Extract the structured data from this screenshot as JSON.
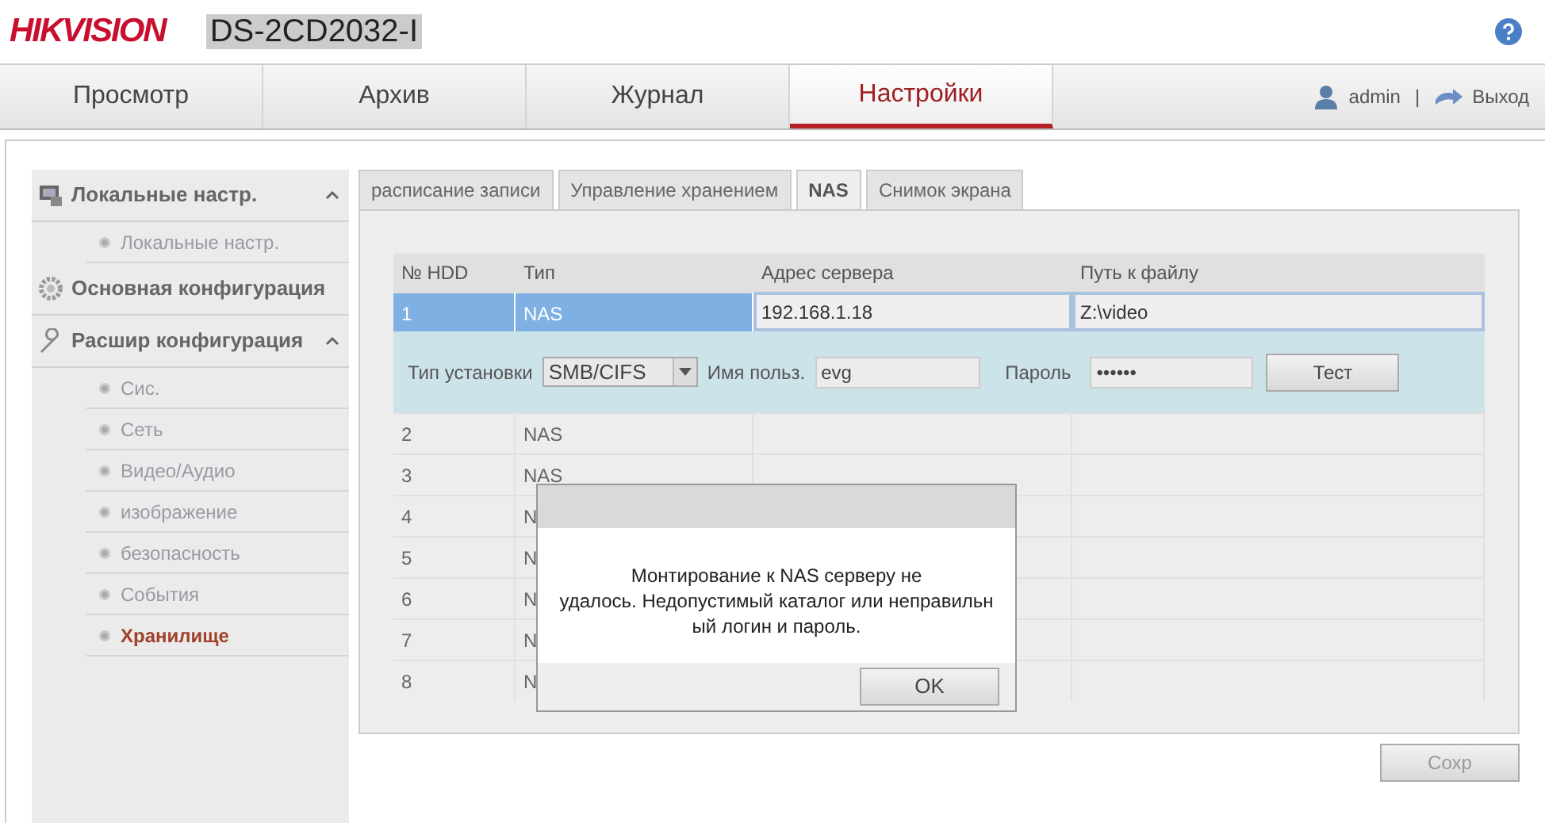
{
  "header": {
    "logo": "HIKVISION",
    "device": "DS-2CD2032-I"
  },
  "nav": {
    "tabs": [
      {
        "label": "Просмотр",
        "selected": false
      },
      {
        "label": "Архив",
        "selected": false
      },
      {
        "label": "Журнал",
        "selected": false
      },
      {
        "label": "Настройки",
        "selected": true
      }
    ],
    "user": "admin",
    "separator": "|",
    "logout": "Выход"
  },
  "sidebar": {
    "groups": [
      {
        "label": "Локальные настр.",
        "expanded": true,
        "children": [
          {
            "label": "Локальные настр.",
            "selected": false
          }
        ]
      },
      {
        "label": "Основная конфигурация",
        "expanded": false
      },
      {
        "label": "Расшир конфигурация",
        "expanded": true,
        "children": [
          {
            "label": "Сис.",
            "selected": false
          },
          {
            "label": "Сеть",
            "selected": false
          },
          {
            "label": "Видео/Аудио",
            "selected": false
          },
          {
            "label": "изображение",
            "selected": false
          },
          {
            "label": "безопасность",
            "selected": false
          },
          {
            "label": "События",
            "selected": false
          },
          {
            "label": "Хранилище",
            "selected": true
          }
        ]
      }
    ]
  },
  "subtabs": [
    {
      "label": "расписание записи",
      "selected": false
    },
    {
      "label": "Управление хранением",
      "selected": false
    },
    {
      "label": "NAS",
      "selected": true
    },
    {
      "label": "Снимок экрана",
      "selected": false
    }
  ],
  "table": {
    "columns": [
      "№ HDD",
      "Тип",
      "Адрес сервера",
      "Путь к файлу"
    ],
    "rows": [
      {
        "cells": [
          "1",
          "NAS",
          "192.168.1.18",
          "Z:\\video"
        ],
        "selected": true
      },
      {
        "cells": [
          "2",
          "NAS"
        ],
        "selected": false
      },
      {
        "cells": [
          "3",
          "NAS"
        ],
        "selected": false
      },
      {
        "cells": [
          "4",
          "N"
        ],
        "selected": false
      },
      {
        "cells": [
          "5",
          "N"
        ],
        "selected": false
      },
      {
        "cells": [
          "6",
          "N"
        ],
        "selected": false
      },
      {
        "cells": [
          "7",
          "N"
        ],
        "selected": false
      },
      {
        "cells": [
          "8",
          "N"
        ],
        "selected": false
      }
    ],
    "detail": {
      "mount_type_label": "Тип установки",
      "mount_type": "SMB/CIFS",
      "user_label": "Имя польз.",
      "user": "evg",
      "password_label": "Пароль",
      "password": "••••••",
      "test_button": "Тест"
    }
  },
  "save_button": "Сохр",
  "dialog": {
    "message": "Монтирование к NAS серверу не\nудалось. Недопустимый каталог или неправильн\nый логин и пароль.",
    "ok_button": "OK"
  }
}
